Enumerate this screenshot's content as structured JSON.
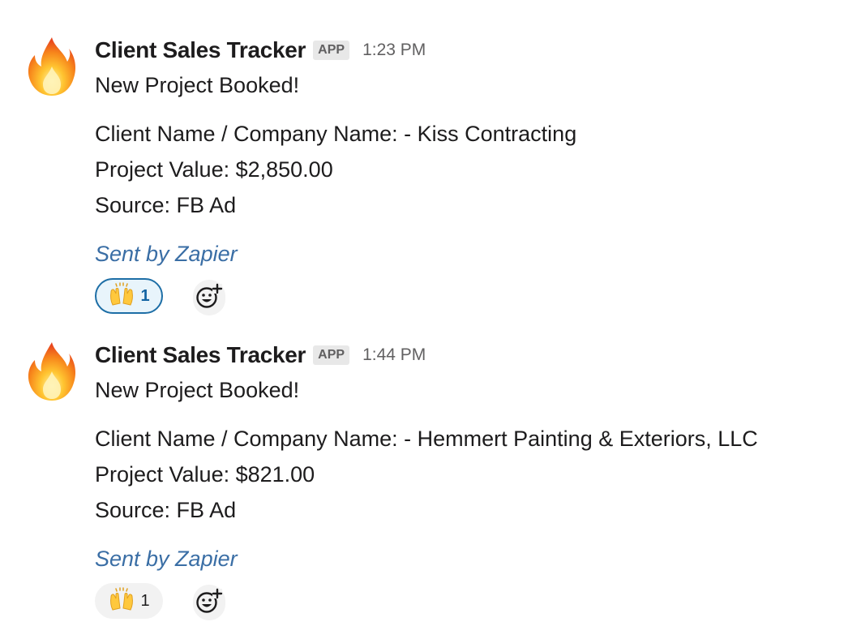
{
  "messages": [
    {
      "sender": "Client Sales Tracker",
      "badge": "APP",
      "time": "1:23 PM",
      "lines": [
        "New Project Booked!",
        "Client Name / Company Name:  - Kiss Contracting",
        "Project Value: $2,850.00",
        "Source: FB Ad"
      ],
      "footer": "Sent by Zapier",
      "reaction": {
        "emoji": "raised-hands-icon",
        "count": "1",
        "active": true
      }
    },
    {
      "sender": "Client Sales Tracker",
      "badge": "APP",
      "time": "1:44 PM",
      "lines": [
        "New Project Booked!",
        "Client Name / Company Name:  - Hemmert Painting & Exteriors, LLC",
        "Project Value: $821.00",
        "Source: FB Ad"
      ],
      "footer": "Sent by Zapier",
      "reaction": {
        "emoji": "raised-hands-icon",
        "count": "1",
        "active": false
      }
    }
  ],
  "colors": {
    "link": "#3a6ea5",
    "reaction_active_border": "#1d6ea6",
    "reaction_active_bg": "#e8f4fb",
    "muted": "#616061"
  },
  "icons": {
    "avatar": "fire-icon",
    "reaction": "raised-hands-icon",
    "add_reaction": "add-reaction-icon"
  }
}
